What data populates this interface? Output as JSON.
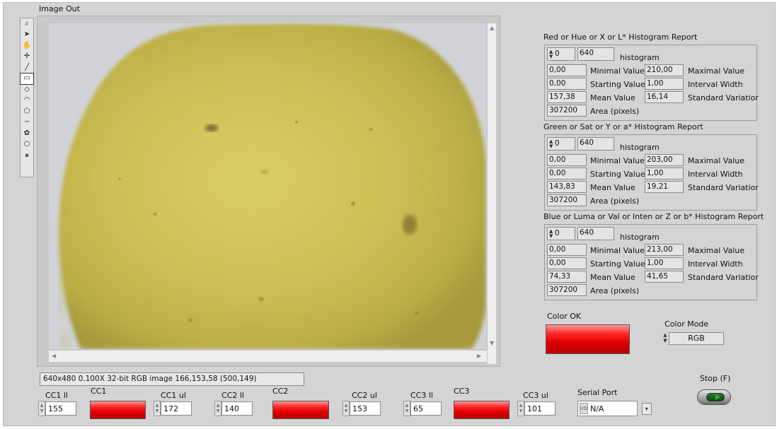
{
  "image_out_label": "Image Out",
  "toolbar": {
    "tools": [
      {
        "name": "zoom-icon",
        "glyph": "⌕"
      },
      {
        "name": "pointer-icon",
        "glyph": "➤"
      },
      {
        "name": "pan-hand-icon",
        "glyph": "✋"
      },
      {
        "name": "crosshair-point-icon",
        "glyph": "✛"
      },
      {
        "name": "line-tool-icon",
        "glyph": "╱"
      },
      {
        "name": "rectangle-tool-icon",
        "glyph": "▭"
      },
      {
        "name": "rotated-rectangle-icon",
        "glyph": "◇"
      },
      {
        "name": "annulus-icon",
        "glyph": "◠"
      },
      {
        "name": "polygon-tool-icon",
        "glyph": "⬠"
      },
      {
        "name": "freehand-tool-icon",
        "glyph": "∽"
      },
      {
        "name": "freehand-region-icon",
        "glyph": "✿"
      },
      {
        "name": "oval-tool-icon",
        "glyph": "○"
      },
      {
        "name": "spiral-tool-icon",
        "glyph": "๑"
      }
    ]
  },
  "status_bar": "640x480 0.100X 32-bit RGB image 166,153,58   (500,149)",
  "reports": [
    {
      "title": "Red or Hue or X or L* Histogram Report",
      "index": "0",
      "hist_size": "640",
      "hist_label": "histogram",
      "min_value": "0,00",
      "min_label": "Minimal Value",
      "max_value": "210,00",
      "max_label": "Maximal Value",
      "start_value": "0,00",
      "start_label": "Starting Value",
      "interval_value": "1,00",
      "interval_label": "Interval Width",
      "mean_value": "157,38",
      "mean_label": "Mean Value",
      "std_value": "16,14",
      "std_label": "Standard Variatior",
      "area_value": "307200",
      "area_label": "Area (pixels)"
    },
    {
      "title": "Green or Sat or Y or a* Histogram Report",
      "index": "0",
      "hist_size": "640",
      "hist_label": "histogram",
      "min_value": "0,00",
      "min_label": "Minimal Value",
      "max_value": "203,00",
      "max_label": "Maximal Value",
      "start_value": "0,00",
      "start_label": "Starting Value",
      "interval_value": "1,00",
      "interval_label": "Interval Width",
      "mean_value": "143,83",
      "mean_label": "Mean Value",
      "std_value": "19,21",
      "std_label": "Standard Variatior",
      "area_value": "307200",
      "area_label": "Area (pixels)"
    },
    {
      "title": "Blue or Luma or Val or Inten or Z or b* Histogram Report",
      "index": "0",
      "hist_size": "640",
      "hist_label": "histogram",
      "min_value": "0,00",
      "min_label": "Minimal Value",
      "max_value": "213,00",
      "max_label": "Maximal Value",
      "start_value": "0,00",
      "start_label": "Starting Value",
      "interval_value": "1,00",
      "interval_label": "Interval Width",
      "mean_value": "74,33",
      "mean_label": "Mean Value",
      "std_value": "41,65",
      "std_label": "Standard Variatior",
      "area_value": "307200",
      "area_label": "Area (pixels)"
    }
  ],
  "color_ok": {
    "label": "Color OK",
    "color": "#e00000"
  },
  "color_mode": {
    "label": "Color Mode",
    "value": "RGB"
  },
  "stop": {
    "label": "Stop (F)"
  },
  "serial_port": {
    "label": "Serial Port",
    "value": "N/A"
  },
  "controls": {
    "cc1_ll": {
      "label": "CC1 ll",
      "value": "155"
    },
    "cc1": {
      "label": "CC1",
      "color": "#e00000"
    },
    "cc1_ul": {
      "label": "CC1 ul",
      "value": "172"
    },
    "cc2_ll": {
      "label": "CC2 ll",
      "value": "140"
    },
    "cc2": {
      "label": "CC2",
      "color": "#e00000"
    },
    "cc2_ul": {
      "label": "CC2 ul",
      "value": "153"
    },
    "cc3_ll": {
      "label": "CC3 ll",
      "value": "65"
    },
    "cc3": {
      "label": "CC3",
      "color": "#e00000"
    },
    "cc3_ul": {
      "label": "CC3 ul",
      "value": "101"
    }
  },
  "image_content": {
    "subject": "apple-photo",
    "dominant_color": "#cfc35a"
  }
}
